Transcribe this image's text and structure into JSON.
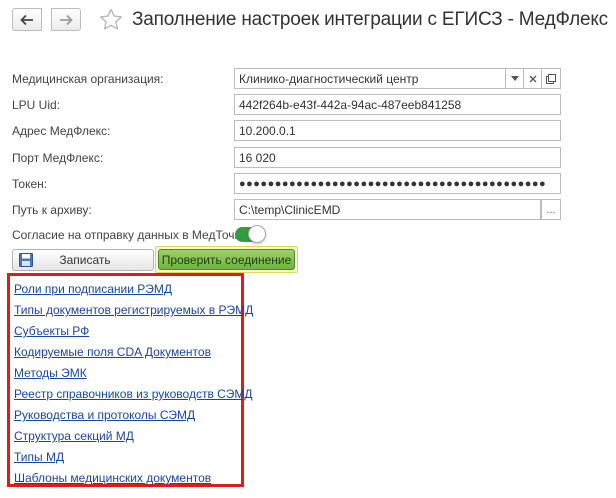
{
  "header": {
    "title": "Заполнение настроек интеграции с ЕГИСЗ - МедФлекс",
    "icons": {
      "back": "arrow-left-icon",
      "forward": "arrow-right-icon",
      "favorite": "star-icon"
    }
  },
  "form": {
    "org": {
      "label": "Медицинская организация:",
      "value": "Клинико-диагностический центр"
    },
    "lpu": {
      "label": "LPU Uid:",
      "value": "442f264b-e43f-442a-94ac-487eeb841258"
    },
    "address": {
      "label": "Адрес МедФлекс:",
      "value": "10.200.0.1"
    },
    "port": {
      "label": "Порт МедФлекс:",
      "value": "16 020"
    },
    "token": {
      "label": "Токен:",
      "value": "●●●●●●●●●●●●●●●●●●●●●●●●●●●●●●●●●●●●●●●●●●●"
    },
    "archive": {
      "label": "Путь к архиву:",
      "value": "C:\\temp\\ClinicEMD",
      "button": "..."
    },
    "consent": {
      "label": "Согласие на отправку данных в МедТочка:",
      "enabled": true
    }
  },
  "buttons": {
    "save": "Записать",
    "check": "Проверить соединение"
  },
  "links": [
    "Роли при подписании РЭМД",
    "Типы документов регистрируемых в РЭМД",
    "Субъекты РФ",
    "Кодируемые поля CDA Документов",
    "Методы ЭМК",
    "Реестр справочников из руководств СЭМД",
    "Руководства и протоколы СЭМД",
    "Структура секций МД",
    "Типы МД",
    "Шаблоны медицинских документов"
  ],
  "colors": {
    "accent_green": "#72b33c",
    "toggle_on": "#2e9e41",
    "link": "#1a46a8",
    "highlight": "#e01b1b"
  }
}
